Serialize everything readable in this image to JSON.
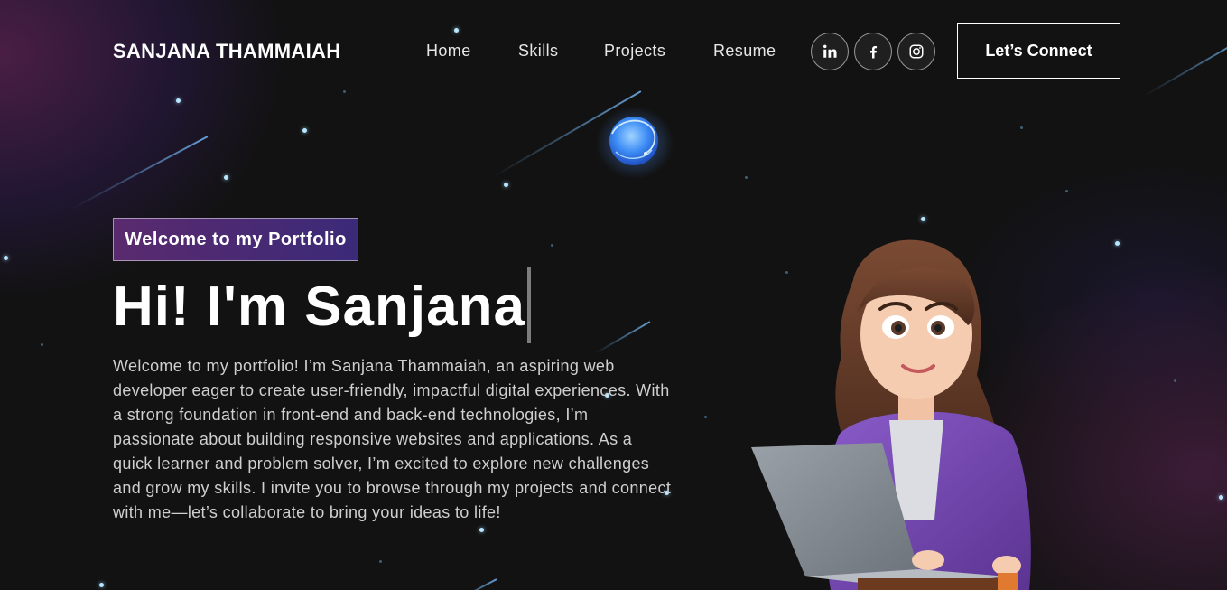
{
  "brand": "SANJANA THAMMAIAH",
  "nav": {
    "links": [
      "Home",
      "Skills",
      "Projects",
      "Resume"
    ],
    "social": [
      {
        "icon": "linkedin-icon",
        "label": "in"
      },
      {
        "icon": "facebook-icon",
        "label": "f"
      },
      {
        "icon": "instagram-icon",
        "label": ""
      }
    ],
    "cta": "Let’s Connect"
  },
  "hero": {
    "tagline": "Welcome to my Portfolio",
    "title": "Hi! I'm Sanjana",
    "intro": "Welcome to my portfolio! I’m Sanjana Thammaiah, an aspiring web developer eager to create user-friendly, impactful digital experiences. With a strong foundation in front-end and back-end technologies, I’m passionate about building responsive websites and applications. As a quick learner and problem solver, I’m excited to explore new challenges and grow my skills. I invite you to browse through my projects and connect with me—let’s collaborate to bring your ideas to life!"
  },
  "colors": {
    "background": "#121212",
    "accent_purple": "#5a2a6e",
    "accent_indigo": "#3b2a78",
    "text_muted": "#cfcfcf"
  }
}
